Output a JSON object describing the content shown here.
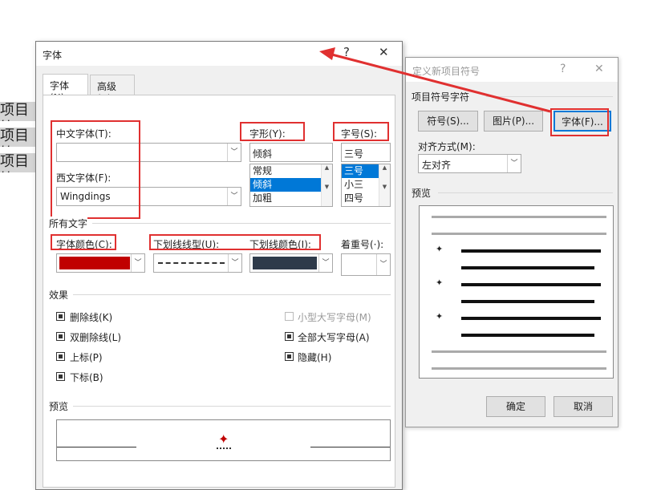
{
  "background": {
    "lines": [
      "项目符",
      "项目符",
      "项目符"
    ]
  },
  "font_dialog": {
    "title": "字体",
    "help": "?",
    "close": "✕",
    "tabs": [
      "字体(N)",
      "高级(V)"
    ],
    "chinese_font_label": "中文字体(T):",
    "chinese_font_value": "",
    "western_font_label": "西文字体(F):",
    "western_font_value": "Wingdings",
    "style_label": "字形(Y):",
    "style_value": "倾斜",
    "style_options": [
      "常规",
      "倾斜",
      "加粗"
    ],
    "size_label": "字号(S):",
    "size_value": "三号",
    "size_options": [
      "三号",
      "小三",
      "四号"
    ],
    "all_text_group": "所有文字",
    "color_label": "字体颜色(C):",
    "underline_style_label": "下划线线型(U):",
    "underline_color_label": "下划线颜色(I):",
    "emphasis_label": "着重号(·):",
    "effects_group": "效果",
    "effects": {
      "strike": "删除线(K)",
      "double_strike": "双删除线(L)",
      "superscript": "上标(P)",
      "subscript": "下标(B)",
      "small_caps": "小型大写字母(M)",
      "all_caps": "全部大写字母(A)",
      "hidden": "隐藏(H)"
    },
    "preview_group": "预览",
    "font_color": "#c00000",
    "underline_color": "#2e3a4a"
  },
  "bullet_dialog": {
    "title": "定义新项目符号",
    "help": "?",
    "close": "✕",
    "section_label": "项目符号字符",
    "symbol_button": "符号(S)...",
    "picture_button": "图片(P)...",
    "font_button": "字体(F)...",
    "align_label": "对齐方式(M):",
    "align_value": "左对齐",
    "preview_label": "预览",
    "ok_button": "确定",
    "cancel_button": "取消"
  },
  "colors": {
    "annotation_red": "#e03030",
    "selection_blue": "#0078d7"
  }
}
